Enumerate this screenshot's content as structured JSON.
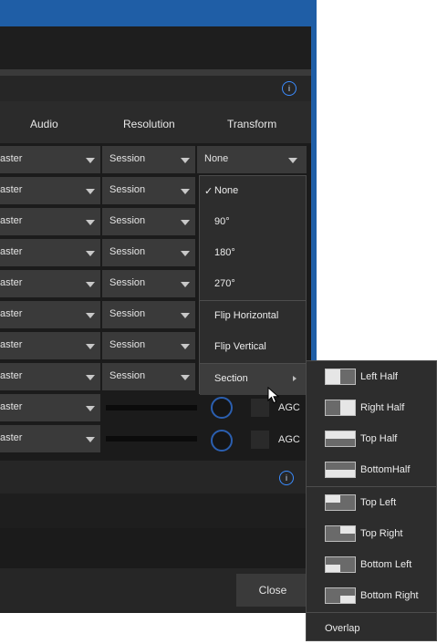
{
  "colors": {
    "titlebar": "#1f5ea6",
    "info_ring": "#3b8cff",
    "knob_ring": "#2b5fb0"
  },
  "columns": {
    "audio": "Audio",
    "resolution": "Resolution",
    "transform": "Transform"
  },
  "rows": [
    {
      "audio": "aster",
      "resolution": "Session"
    },
    {
      "audio": "aster",
      "resolution": "Session"
    },
    {
      "audio": "aster",
      "resolution": "Session"
    },
    {
      "audio": "aster",
      "resolution": "Session"
    },
    {
      "audio": "aster",
      "resolution": "Session"
    },
    {
      "audio": "aster",
      "resolution": "Session"
    },
    {
      "audio": "aster",
      "resolution": "Session"
    },
    {
      "audio": "aster",
      "resolution": "Session"
    },
    {
      "audio": "aster"
    },
    {
      "audio": "aster"
    }
  ],
  "transform_dropdown": {
    "value": "None"
  },
  "agc_label": "AGC",
  "info_glyph": "i",
  "transform_menu": {
    "items": [
      {
        "label": "None",
        "check": "✓"
      },
      {
        "label": "90°"
      },
      {
        "label": "180°"
      },
      {
        "label": "270°"
      },
      {
        "label": "Flip Horizontal"
      },
      {
        "label": "Flip Vertical"
      },
      {
        "label": "Section"
      }
    ]
  },
  "section_menu": {
    "items": [
      {
        "label": "Left Half",
        "icon": "left-half-icon"
      },
      {
        "label": "Right Half",
        "icon": "right-half-icon"
      },
      {
        "label": "Top Half",
        "icon": "top-half-icon"
      },
      {
        "label": "BottomHalf",
        "icon": "bottom-half-icon"
      },
      {
        "label": "Top Left",
        "icon": "top-left-icon"
      },
      {
        "label": "Top Right",
        "icon": "top-right-icon"
      },
      {
        "label": "Bottom Left",
        "icon": "bottom-left-icon"
      },
      {
        "label": "Bottom Right",
        "icon": "bottom-right-icon"
      },
      {
        "label": "Overlap"
      }
    ]
  },
  "footer": {
    "close_label": "Close"
  }
}
